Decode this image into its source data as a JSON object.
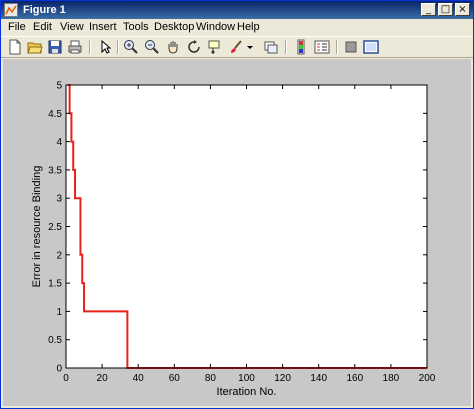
{
  "window": {
    "title": "Figure 1",
    "buttons": [
      "_",
      "□",
      "×"
    ]
  },
  "menu": [
    "File",
    "Edit",
    "View",
    "Insert",
    "Tools",
    "Desktop",
    "Window",
    "Help"
  ],
  "toolbar_icons": [
    "new-figure-icon",
    "open-file-icon",
    "save-icon",
    "print-icon",
    "arrow-select-icon",
    "zoom-in-icon",
    "zoom-out-icon",
    "pan-hand-icon",
    "rotate-3d-icon",
    "data-cursor-icon",
    "brush-icon",
    "brush-dropdown-icon",
    "link-plot-icon",
    "colorbar-icon",
    "legend-icon",
    "hide-plot-tools-icon",
    "show-plot-tools-icon"
  ],
  "chart_data": {
    "type": "line",
    "xlabel": "Iteration No.",
    "ylabel": "Error in resource Binding",
    "xlim": [
      0,
      200
    ],
    "ylim": [
      0,
      5
    ],
    "xticks": [
      0,
      20,
      40,
      60,
      80,
      100,
      120,
      140,
      160,
      180,
      200
    ],
    "yticks": [
      0,
      0.5,
      1,
      1.5,
      2,
      2.5,
      3,
      3.5,
      4,
      4.5,
      5
    ],
    "line_color": "#e8221b",
    "series": [
      {
        "x": [
          1,
          2,
          2,
          3,
          3,
          4,
          4,
          5,
          5,
          8,
          8,
          9,
          9,
          10,
          10,
          34,
          34,
          200
        ],
        "y": [
          5,
          5,
          4.5,
          4.5,
          4,
          4,
          3.5,
          3.5,
          3,
          3,
          2,
          2,
          1.5,
          1.5,
          1,
          1,
          0,
          0
        ]
      }
    ]
  }
}
